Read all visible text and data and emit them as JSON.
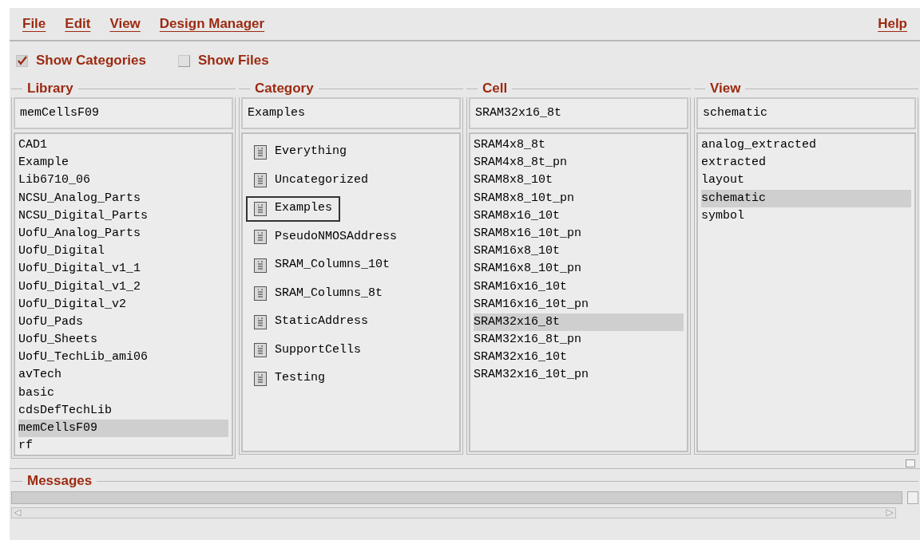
{
  "menu": [
    {
      "label": "File"
    },
    {
      "label": "Edit"
    },
    {
      "label": "View"
    },
    {
      "label": "Design Manager"
    }
  ],
  "help": {
    "label": "Help"
  },
  "options": [
    {
      "label": "Show Categories",
      "checked": true
    },
    {
      "label": "Show Files",
      "checked": false
    }
  ],
  "library": {
    "title": "Library",
    "value": "memCellsF09",
    "items": [
      {
        "label": "CAD1",
        "selected": false
      },
      {
        "label": "Example",
        "selected": false
      },
      {
        "label": "Lib6710_06",
        "selected": false
      },
      {
        "label": "NCSU_Analog_Parts",
        "selected": false
      },
      {
        "label": "NCSU_Digital_Parts",
        "selected": false
      },
      {
        "label": "UofU_Analog_Parts",
        "selected": false
      },
      {
        "label": "UofU_Digital",
        "selected": false
      },
      {
        "label": "UofU_Digital_v1_1",
        "selected": false
      },
      {
        "label": "UofU_Digital_v1_2",
        "selected": false
      },
      {
        "label": "UofU_Digital_v2",
        "selected": false
      },
      {
        "label": "UofU_Pads",
        "selected": false
      },
      {
        "label": "UofU_Sheets",
        "selected": false
      },
      {
        "label": "UofU_TechLib_ami06",
        "selected": false
      },
      {
        "label": "avTech",
        "selected": false
      },
      {
        "label": "basic",
        "selected": false
      },
      {
        "label": "cdsDefTechLib",
        "selected": false
      },
      {
        "label": "memCellsF09",
        "selected": true
      },
      {
        "label": "rf",
        "selected": false
      }
    ]
  },
  "category": {
    "title": "Category",
    "value": "Examples",
    "items": [
      {
        "label": "Everything",
        "selected": false
      },
      {
        "label": "Uncategorized",
        "selected": false
      },
      {
        "label": "Examples",
        "selected": true
      },
      {
        "label": "PseudoNMOSAddress",
        "selected": false
      },
      {
        "label": "SRAM_Columns_10t",
        "selected": false
      },
      {
        "label": "SRAM_Columns_8t",
        "selected": false
      },
      {
        "label": "StaticAddress",
        "selected": false
      },
      {
        "label": "SupportCells",
        "selected": false
      },
      {
        "label": "Testing",
        "selected": false
      }
    ]
  },
  "cell": {
    "title": "Cell",
    "value": "SRAM32x16_8t",
    "items": [
      {
        "label": "SRAM4x8_8t",
        "selected": false
      },
      {
        "label": "SRAM4x8_8t_pn",
        "selected": false
      },
      {
        "label": "SRAM8x8_10t",
        "selected": false
      },
      {
        "label": "SRAM8x8_10t_pn",
        "selected": false
      },
      {
        "label": "SRAM8x16_10t",
        "selected": false
      },
      {
        "label": "SRAM8x16_10t_pn",
        "selected": false
      },
      {
        "label": "SRAM16x8_10t",
        "selected": false
      },
      {
        "label": "SRAM16x8_10t_pn",
        "selected": false
      },
      {
        "label": "SRAM16x16_10t",
        "selected": false
      },
      {
        "label": "SRAM16x16_10t_pn",
        "selected": false
      },
      {
        "label": "SRAM32x16_8t",
        "selected": true
      },
      {
        "label": "SRAM32x16_8t_pn",
        "selected": false
      },
      {
        "label": "SRAM32x16_10t",
        "selected": false
      },
      {
        "label": "SRAM32x16_10t_pn",
        "selected": false
      }
    ]
  },
  "view": {
    "title": "View",
    "value": "schematic",
    "items": [
      {
        "label": "analog_extracted",
        "selected": false
      },
      {
        "label": "extracted",
        "selected": false
      },
      {
        "label": "layout",
        "selected": false
      },
      {
        "label": "schematic",
        "selected": true
      },
      {
        "label": "symbol",
        "selected": false
      }
    ]
  },
  "messages": {
    "title": "Messages"
  }
}
